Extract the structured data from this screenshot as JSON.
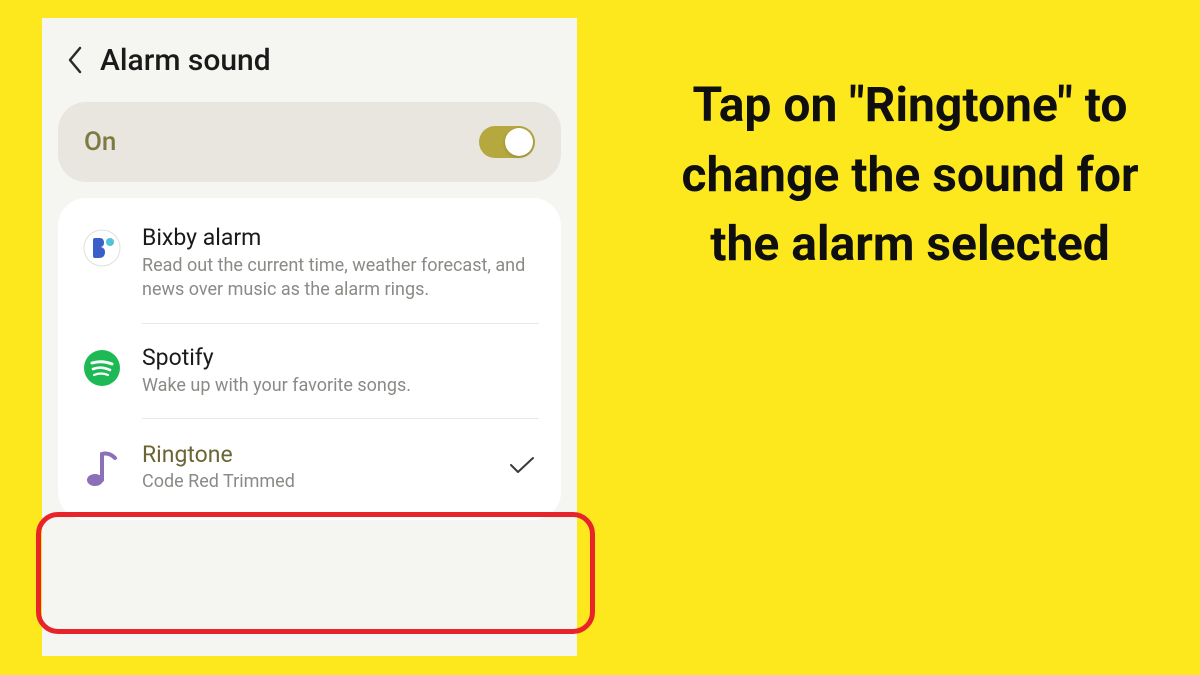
{
  "header": {
    "title": "Alarm sound"
  },
  "toggle": {
    "label": "On",
    "state": "on"
  },
  "options": {
    "bixby": {
      "title": "Bixby alarm",
      "subtitle": "Read out the current time, weather forecast, and news over music as the alarm rings."
    },
    "spotify": {
      "title": "Spotify",
      "subtitle": "Wake up with your favorite songs."
    },
    "ringtone": {
      "title": "Ringtone",
      "subtitle": "Code Red Trimmed"
    }
  },
  "instruction": "Tap on \"Ringtone\" to change the sound for the alarm selected",
  "colors": {
    "background": "#fde81e",
    "highlight": "#e8242a",
    "accent": "#b5a83e"
  }
}
